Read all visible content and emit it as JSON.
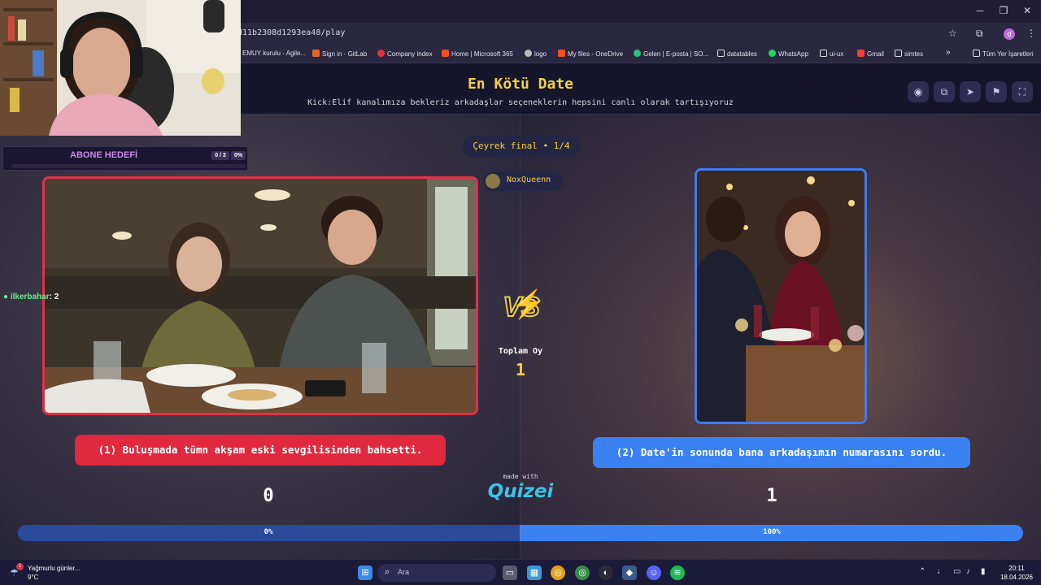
{
  "browser": {
    "url": "d11b2308d1293ea48/play",
    "profile_initial": "d",
    "bookmarks": [
      {
        "label": "EMUY kurulu - Agile..."
      },
      {
        "label": "Sign in · GitLab"
      },
      {
        "label": "Company index"
      },
      {
        "label": "Home | Microsoft 365"
      },
      {
        "label": "logo"
      },
      {
        "label": "My files - OneDrive"
      },
      {
        "label": "Gelen | E-posta | SO..."
      },
      {
        "label": "datatables"
      },
      {
        "label": "WhatsApp"
      },
      {
        "label": "ui-ux"
      },
      {
        "label": "Gmail"
      },
      {
        "label": "simtes"
      }
    ],
    "more_bookmarks": "»",
    "all_bookmarks": "Tüm Yer İşaretleri"
  },
  "app": {
    "title": "En Kötü Date",
    "subtitle": "Kick:Elif kanalımıza bekleriz arkadaşlar seçeneklerin hepsini canlı olarak tartışıyoruz",
    "round": "Çeyrek final • 1/4",
    "player": "NoxQueenn",
    "vs": "VS",
    "total_votes_label": "Toplam Oy",
    "total_votes": "1",
    "made_with": "made with",
    "logo": "Quizei"
  },
  "options": {
    "left": {
      "label": "(1) Buluşmada tümn akşam eski sevgilisinden bahsetti.",
      "score": "0",
      "percent_label": "0%",
      "percent": 0,
      "color": "#e0283f"
    },
    "right": {
      "label": "(2) Date'in sonunda bana arkadaşımın numarasını sordu.",
      "score": "1",
      "percent_label": "100%",
      "percent": 100,
      "color": "#3a82f2"
    }
  },
  "overlay": {
    "sub_goal_title": "ABONE HEDEFİ",
    "sub_goal_count": "0 / 3",
    "sub_goal_percent_label": "0%",
    "sub_goal_percent": 0,
    "chat_user": "ilkerbahar",
    "chat_count": ": 2"
  },
  "taskbar": {
    "weather_title": "Yağmurlu günler...",
    "weather_temp": "9°C",
    "weather_badge": "1",
    "search_placeholder": "Ara",
    "time": "20:11",
    "date": "18.04.2026"
  }
}
